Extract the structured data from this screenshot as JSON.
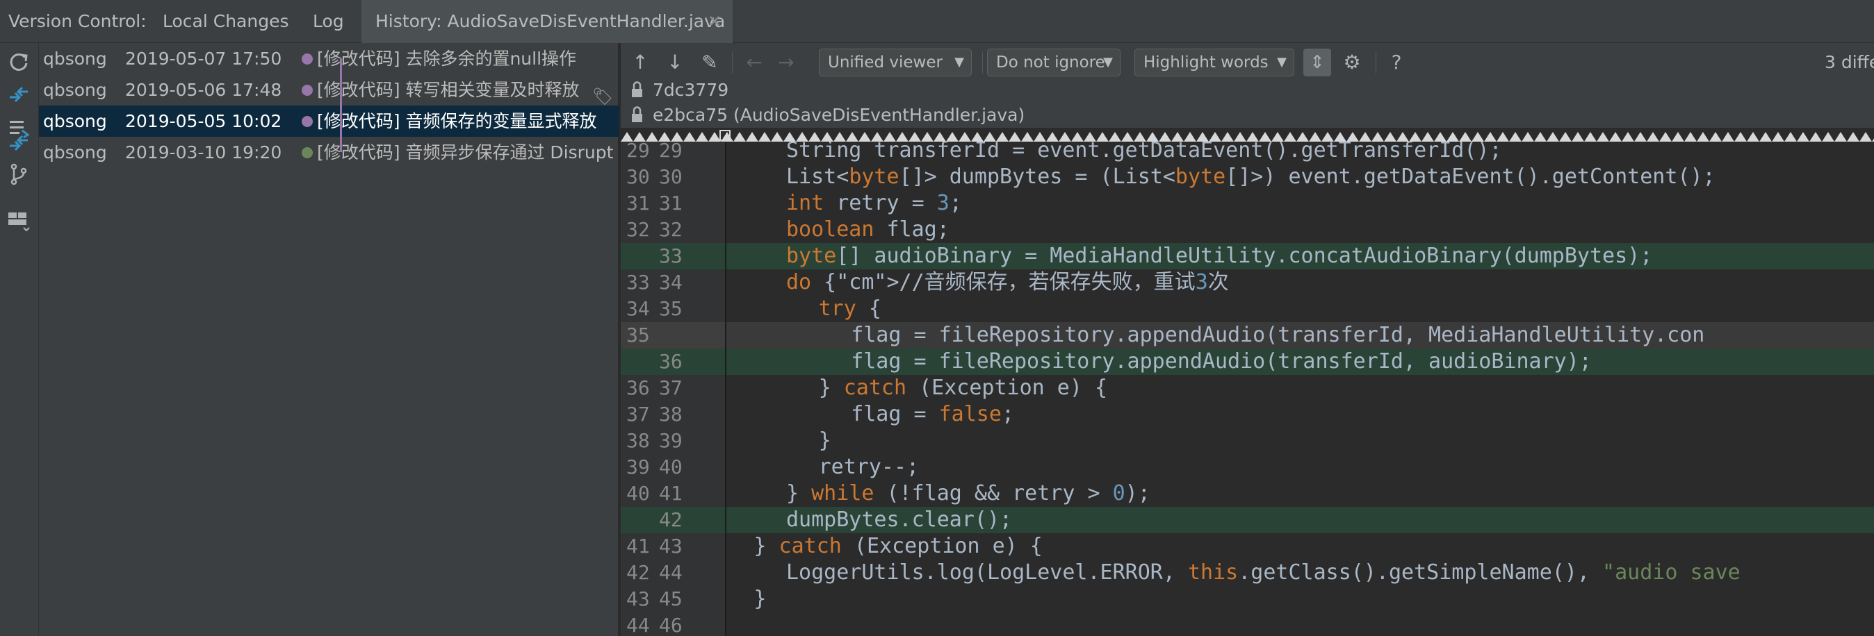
{
  "tabs": [
    {
      "label": "Version Control:",
      "active": false
    },
    {
      "label": "Local Changes",
      "active": false
    },
    {
      "label": "Log",
      "active": false
    },
    {
      "label": "History: AudioSaveDisEventHandler.java",
      "active": true
    }
  ],
  "left_toolbar": {
    "icons": [
      "refresh-icon",
      "compare-icon",
      "list-icon",
      "compare-with-local-icon",
      "branch-icon",
      "layout-icon"
    ]
  },
  "commits": [
    {
      "author": "qbsong",
      "date": "2019-05-07 17:50",
      "message": "[修改代码] 去除多余的置null操作",
      "dot_color": "#9876aa",
      "selected": false,
      "tag": false
    },
    {
      "author": "qbsong",
      "date": "2019-05-06 17:48",
      "message": "[修改代码] 转写相关变量及时释放",
      "dot_color": "#9876aa",
      "selected": false,
      "tag": true
    },
    {
      "author": "qbsong",
      "date": "2019-05-05 10:02",
      "message": "[修改代码] 音频保存的变量显式释放",
      "dot_color": "#9876aa",
      "selected": true,
      "tag": false
    },
    {
      "author": "qbsong",
      "date": "2019-03-10 19:20",
      "message": "[修改代码] 音频异步保存通过 Disrupt",
      "dot_color": "#6a8759",
      "selected": false,
      "tag": false
    }
  ],
  "diff_toolbar": {
    "viewer_combo": "Unified viewer",
    "ignore_combo": "Do not ignore",
    "highlight_combo": "Highlight words",
    "diff_count": "3 diffe",
    "help": "?"
  },
  "revisions": {
    "left": "7dc3779",
    "right": "e2bca75 (AudioSaveDisEventHandler.java)"
  },
  "code_lines": [
    {
      "l1": "29",
      "l2": "29",
      "kind": "normal"
    },
    {
      "l1": "30",
      "l2": "30",
      "kind": "normal"
    },
    {
      "l1": "31",
      "l2": "31",
      "kind": "normal"
    },
    {
      "l1": "32",
      "l2": "32",
      "kind": "normal"
    },
    {
      "l1": "",
      "l2": "33",
      "kind": "added"
    },
    {
      "l1": "33",
      "l2": "34",
      "kind": "normal"
    },
    {
      "l1": "34",
      "l2": "35",
      "kind": "normal"
    },
    {
      "l1": "35",
      "l2": "",
      "kind": "changed"
    },
    {
      "l1": "",
      "l2": "36",
      "kind": "added"
    },
    {
      "l1": "36",
      "l2": "37",
      "kind": "normal"
    },
    {
      "l1": "37",
      "l2": "38",
      "kind": "normal"
    },
    {
      "l1": "38",
      "l2": "39",
      "kind": "normal"
    },
    {
      "l1": "39",
      "l2": "40",
      "kind": "normal"
    },
    {
      "l1": "40",
      "l2": "41",
      "kind": "normal"
    },
    {
      "l1": "",
      "l2": "42",
      "kind": "added"
    },
    {
      "l1": "41",
      "l2": "43",
      "kind": "normal"
    },
    {
      "l1": "42",
      "l2": "44",
      "kind": "normal"
    },
    {
      "l1": "43",
      "l2": "45",
      "kind": "normal"
    },
    {
      "l1": "44",
      "l2": "46",
      "kind": "normal"
    }
  ],
  "code_text": [
    "String transferId = event.getDataEvent().getTransferId();",
    "List<byte[]> dumpBytes = (List<byte[]>) event.getDataEvent().getContent();",
    "int retry = 3;",
    "boolean flag;",
    "byte[] audioBinary = MediaHandleUtility.concatAudioBinary(dumpBytes);",
    "do {//音频保存，若保存失败，重试3次",
    "try {",
    "flag = fileRepository.appendAudio(transferId, MediaHandleUtility.con",
    "flag = fileRepository.appendAudio(transferId, audioBinary);",
    "} catch (Exception e) {",
    "flag = false;",
    "}",
    "retry--;",
    "} while (!flag && retry > 0);",
    "dumpBytes.clear();",
    "} catch (Exception e) {",
    "LoggerUtils.log(LogLevel.ERROR, this.getClass().getSimpleName(), \"audio save",
    "}",
    ""
  ]
}
